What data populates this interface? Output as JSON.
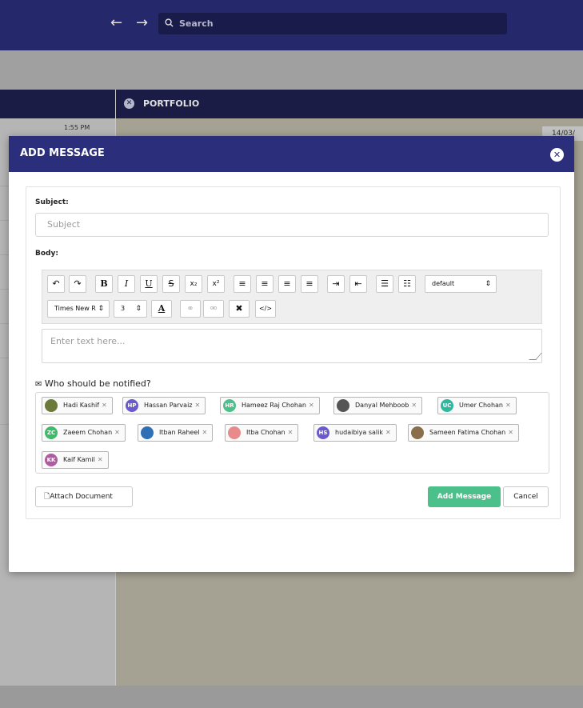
{
  "topbar": {
    "search_placeholder": "Search"
  },
  "left_panel": {
    "time": "1:55 PM"
  },
  "right_panel": {
    "title": "PORTFOLIO",
    "date": "14/03/"
  },
  "modal": {
    "title": "ADD MESSAGE",
    "subject_label": "Subject:",
    "subject_placeholder": "Subject",
    "body_label": "Body:",
    "toolbar": {
      "format_select": "default",
      "font_select": "Times New R",
      "size_select": "3"
    },
    "editor_placeholder": "Enter text here...",
    "notify_label": "Who should be notified?",
    "recipients": [
      {
        "name": "Hadi Kashif",
        "initials": "",
        "color": "#6b7a3a"
      },
      {
        "name": "Hassan Parvaiz",
        "initials": "HP",
        "color": "#6a5acd"
      },
      {
        "name": "Hameez Raj Chohan",
        "initials": "HR",
        "color": "#4cc08a"
      },
      {
        "name": "Danyal Mehboob",
        "initials": "",
        "color": "#555555"
      },
      {
        "name": "Umer Chohan",
        "initials": "UC",
        "color": "#2fb8a0"
      },
      {
        "name": "Zaeem Chohan",
        "initials": "ZC",
        "color": "#3fba6a"
      },
      {
        "name": "Itban Raheel",
        "initials": "",
        "color": "#2e6fb5"
      },
      {
        "name": "Itba Chohan",
        "initials": "",
        "color": "#e98a8a"
      },
      {
        "name": "hudaibiya salik",
        "initials": "HS",
        "color": "#6a5acd"
      },
      {
        "name": "Sameen Fatima Chohan",
        "initials": "",
        "color": "#8a6d4a"
      },
      {
        "name": "Kaif Kamil",
        "initials": "KK",
        "color": "#b05aa0"
      }
    ],
    "attach_label": "Attach Document",
    "add_label": "Add Message",
    "cancel_label": "Cancel"
  }
}
